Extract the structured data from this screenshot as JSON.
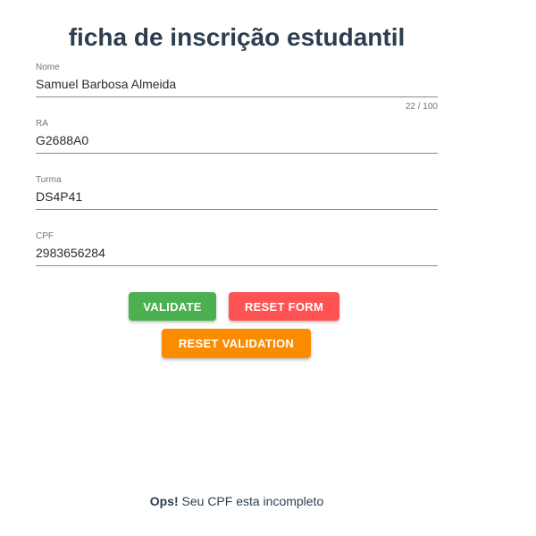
{
  "page": {
    "title": "ficha de inscrição estudantil"
  },
  "form": {
    "nome": {
      "label": "Nome",
      "value": "Samuel Barbosa Almeida",
      "counter": "22 / 100"
    },
    "ra": {
      "label": "RA",
      "value": "G2688A0"
    },
    "turma": {
      "label": "Turma",
      "value": "DS4P41"
    },
    "cpf": {
      "label": "CPF",
      "value": "2983656284"
    }
  },
  "buttons": {
    "validate_label": "VALIDATE",
    "reset_form_label": "RESET FORM",
    "reset_validation_label": "RESET VALIDATION"
  },
  "message": {
    "prefix": "Ops!",
    "text": " Seu CPF esta incompleto"
  },
  "colors": {
    "validate": "#4caf50",
    "reset_form": "#ff5252",
    "reset_validation": "#fb8c00",
    "title": "#2c3e50"
  }
}
